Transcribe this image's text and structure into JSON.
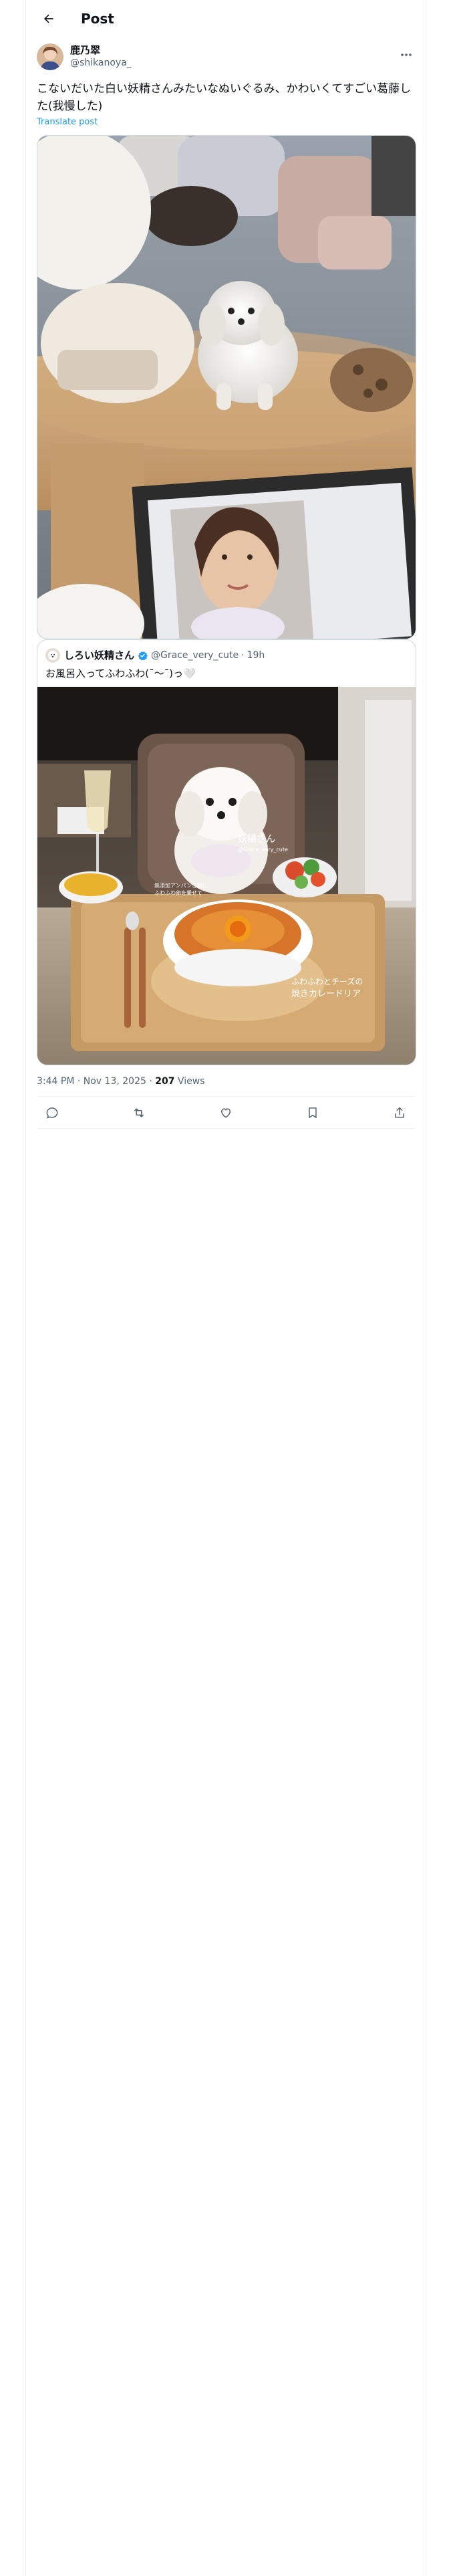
{
  "header": {
    "title": "Post"
  },
  "post": {
    "author": {
      "display_name": "鹿乃翠",
      "handle": "@shikanoya_"
    },
    "text": "こないだいた白い妖精さんみたいなぬいぐるみ、かわいくてすごい葛藤した(我慢した)",
    "translate_label": "Translate post",
    "timestamp": "3:44 PM · Nov 13, 2025 · ",
    "views_count": "207",
    "views_label": " Views"
  },
  "quote": {
    "display_name": "しろい妖精さん",
    "handle": "@Grace_very_cute",
    "time": "19h",
    "text": "お風呂入ってふわふわ(¯〜¯)っ🤍",
    "photo_text": {
      "label_name": "妖精さん",
      "label_handle": "@Grace_very_cute",
      "label_dish_1": "ふわふわとチーズの",
      "label_dish_2": "焼きカレードリア",
      "label_left_1": "無添加アンパンご飯に",
      "label_left_2": "ふわふわ卵を乗せて"
    }
  },
  "actions": {
    "reply": "reply-icon",
    "repost": "repost-icon",
    "like": "heart-icon",
    "bookmark": "bookmark-icon",
    "share": "share-icon"
  },
  "colors": {
    "accent": "#1d9bf0",
    "text": "#0f1419",
    "muted": "#536471",
    "border": "#eff3f4"
  }
}
